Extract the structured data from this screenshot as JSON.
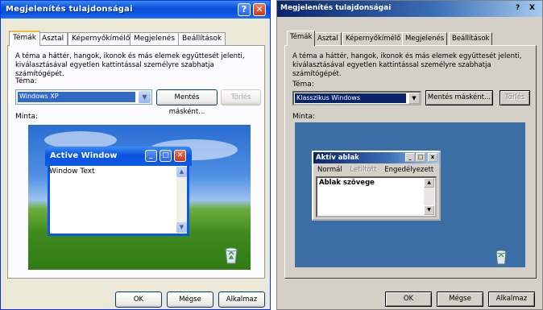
{
  "xp": {
    "title": "Megjelenítés tulajdonságai",
    "help_glyph": "?",
    "close_glyph": "✕",
    "tabs": [
      "Témák",
      "Asztal",
      "Képernyőkímélő",
      "Megjelenés",
      "Beállítások"
    ],
    "active_tab": "Témák",
    "description": "A téma a háttér, hangok, ikonok és más elemek együttesét jelenti, kiválasztásával egyetlen kattintással személyre szabhatja számítógépét.",
    "theme_label": "Téma:",
    "theme_value": "Windows XP",
    "save_as_label": "Mentés másként...",
    "delete_label": "Törlés",
    "sample_label": "Minta:",
    "preview": {
      "window_title": "Active Window",
      "window_text": "Window Text"
    },
    "ok_label": "OK",
    "cancel_label": "Mégse",
    "apply_label": "Alkalmaz"
  },
  "classic": {
    "title": "Megjelenítés tulajdonságai",
    "help_glyph": "?",
    "close_glyph": "X",
    "tabs": [
      "Témák",
      "Asztal",
      "Képernyőkímélő",
      "Megjelenés",
      "Beállítások"
    ],
    "active_tab": "Témák",
    "description": "A téma a háttér, hangok, ikonok és más elemek együttesét jelenti, kiválasztásával egyetlen kattintással személyre szabhatja számítógépét.",
    "theme_label": "Téma:",
    "theme_value": "Klasszikus Windows",
    "save_as_label": "Mentés másként...",
    "delete_label": "Törlés",
    "sample_label": "Minta:",
    "preview": {
      "window_title": "Aktív ablak",
      "menu": [
        "Normál",
        "Letiltott",
        "Engedélyezett"
      ],
      "window_text": "Ablak szövege"
    },
    "ok_label": "OK",
    "cancel_label": "Mégse",
    "apply_label": "Alkalmaz"
  },
  "icons": [
    "help-icon",
    "close-icon",
    "minimize-icon",
    "maximize-icon",
    "dropdown-arrow-icon",
    "scroll-up-icon",
    "scroll-down-icon",
    "recycle-bin-icon"
  ],
  "colors": {
    "xp_title": "#0a53e0",
    "xp_dialog_bg": "#ece9d8",
    "xp_close": "#c8391a",
    "classic_title": "#0a246a",
    "classic_dialog_bg": "#d4d0c8",
    "classic_desktop": "#3a6ea5"
  }
}
